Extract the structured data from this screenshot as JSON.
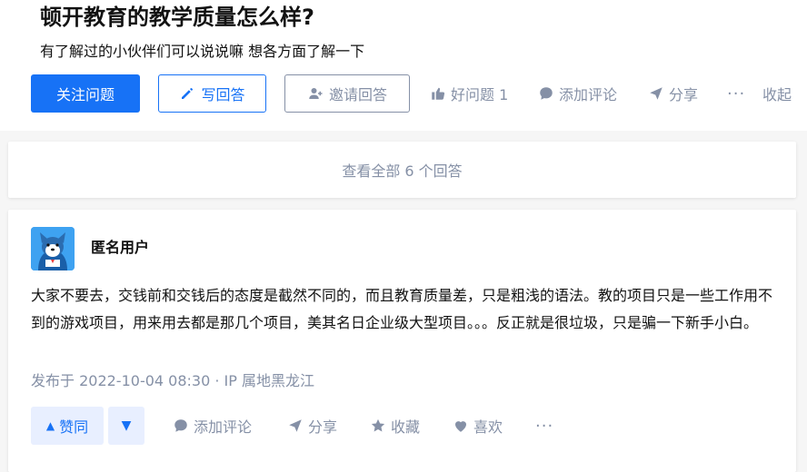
{
  "question": {
    "title": "顿开教育的教学质量怎么样?",
    "detail": "有了解过的小伙伴们可以说说嘛 想各方面了解一下"
  },
  "question_actions": {
    "follow": "关注问题",
    "write_answer": "写回答",
    "invite": "邀请回答",
    "good_question": "好问题 1",
    "add_comment": "添加评论",
    "share": "分享",
    "more": "···",
    "collapse": "收起"
  },
  "view_all": "查看全部 6 个回答",
  "answer": {
    "author": "匿名用户",
    "content": "大家不要去，交钱前和交钱后的态度是截然不同的，而且教育质量差，只是粗浅的语法。教的项目只是一些工作用不到的游戏项目，用来用去都是那几个项目，美其名日企业级大型项目。。。反正就是很垃圾，只是骗一下新手小白。",
    "meta": "发布于 2022-10-04 08:30 · IP 属地黑龙江",
    "actions": {
      "vote_up": "赞同",
      "vote_down": "▼",
      "add_comment": "添加评论",
      "share": "分享",
      "collect": "收藏",
      "like": "喜欢",
      "more": "···"
    }
  },
  "colors": {
    "accent": "#1772f6",
    "muted": "#8590a6",
    "vote_bg": "#e8efff"
  }
}
